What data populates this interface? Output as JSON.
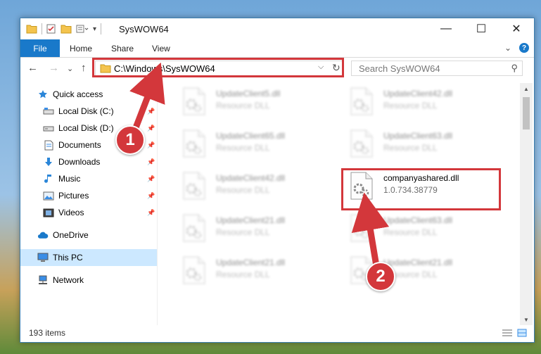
{
  "window": {
    "title": "SysWOW64",
    "controls": {
      "minimize": "—",
      "maximize": "☐",
      "close": "✕"
    }
  },
  "ribbon": {
    "tabs": [
      "File",
      "Home",
      "Share",
      "View"
    ],
    "collapse_glyph": "⌄",
    "help_glyph": "?"
  },
  "address_bar": {
    "path": "C:\\Windows\\SysWOW64",
    "dropdown_glyph": "⌵",
    "refresh_glyph": "↻"
  },
  "search": {
    "placeholder": "Search SysWOW64",
    "icon_glyph": "⚲"
  },
  "nav_buttons": {
    "back": "←",
    "forward": "→",
    "recent": "⌄",
    "up": "↑"
  },
  "nav_pane": {
    "quick_access": "Quick access",
    "items": [
      {
        "label": "Local Disk (C:)",
        "icon": "drive-icon",
        "pinned": true
      },
      {
        "label": "Local Disk (D:)",
        "icon": "drive-icon",
        "pinned": true
      },
      {
        "label": "Documents",
        "icon": "documents-icon",
        "pinned": true
      },
      {
        "label": "Downloads",
        "icon": "downloads-icon",
        "pinned": true
      },
      {
        "label": "Music",
        "icon": "music-icon",
        "pinned": true
      },
      {
        "label": "Pictures",
        "icon": "pictures-icon",
        "pinned": true
      },
      {
        "label": "Videos",
        "icon": "videos-icon",
        "pinned": true
      }
    ],
    "onedrive": "OneDrive",
    "this_pc": "This PC",
    "network": "Network",
    "pin_glyph": "📌"
  },
  "files": [
    {
      "name": "UpdateClient5.dll",
      "desc": "Resource DLL",
      "blurred": true
    },
    {
      "name": "UpdateClient42.dll",
      "desc": "Resource DLL",
      "blurred": true
    },
    {
      "name": "UpdateClient65.dll",
      "desc": "Resource DLL",
      "blurred": true
    },
    {
      "name": "UpdateClient63.dll",
      "desc": "Resource DLL",
      "blurred": true
    },
    {
      "name": "UpdateClient42.dll",
      "desc": "Resource DLL",
      "blurred": true
    },
    {
      "name": "companyashared.dll",
      "desc": "1.0.734.38779",
      "blurred": false
    },
    {
      "name": "UpdateClient21.dll",
      "desc": "Resource DLL",
      "blurred": true
    },
    {
      "name": "UpdateClient63.dll",
      "desc": "Resource DLL",
      "blurred": true
    },
    {
      "name": "UpdateClient21.dll",
      "desc": "Resource DLL",
      "blurred": true
    },
    {
      "name": "UpdateClient21.dll",
      "desc": "Resource DLL",
      "blurred": true
    }
  ],
  "status": {
    "count": "193 items"
  },
  "callouts": {
    "one": "1",
    "two": "2"
  },
  "colors": {
    "accent": "#1979ca",
    "highlight": "#d3373b",
    "selected": "#cce8ff"
  }
}
